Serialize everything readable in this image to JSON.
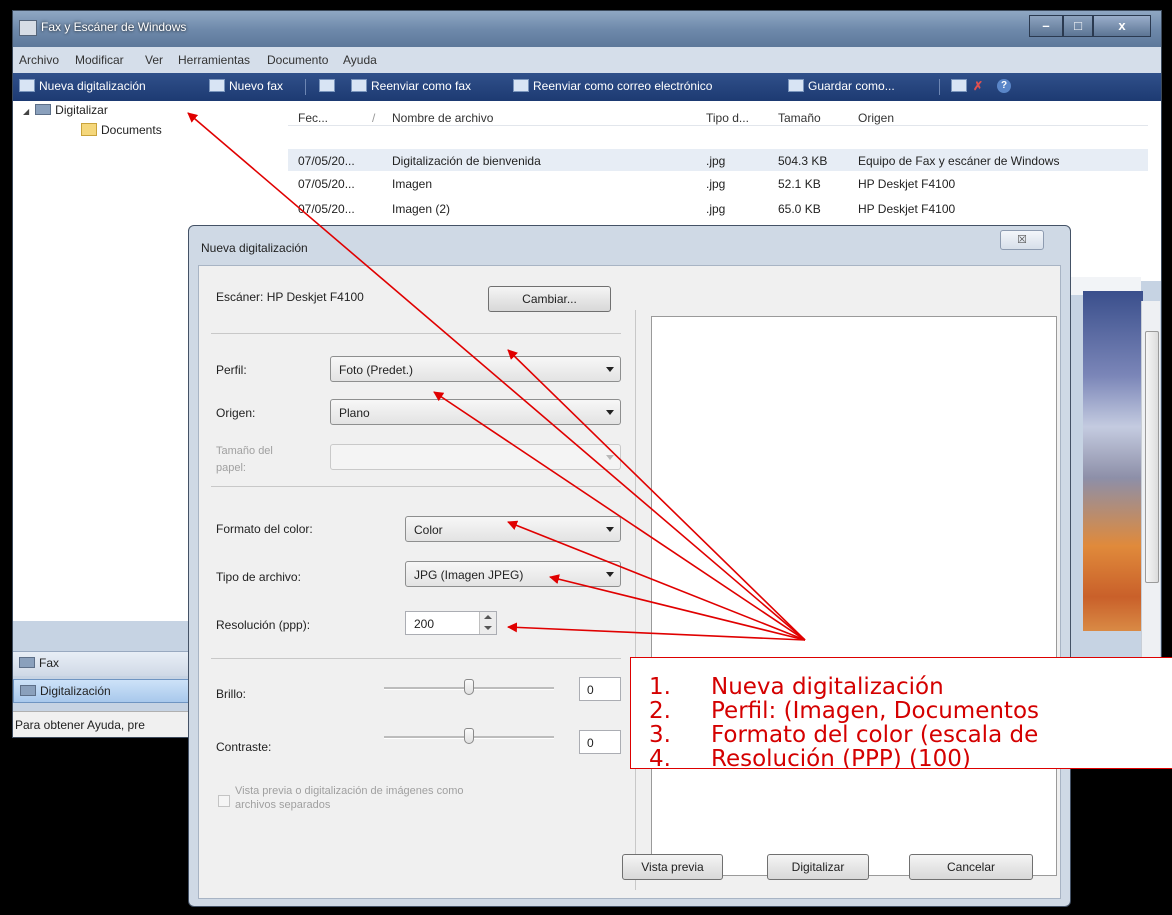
{
  "window": {
    "title": "Fax y Escáner de Windows",
    "min": "–",
    "max": "□",
    "close": "x"
  },
  "menu": [
    "Archivo",
    "Modificar",
    "Ver",
    "Herramientas",
    "Documento",
    "Ayuda"
  ],
  "toolbar": {
    "new_scan": "Nueva digitalización",
    "new_fax": "Nuevo fax",
    "forward_fax": "Reenviar como fax",
    "forward_email": "Reenviar como correo electrónico",
    "save_as": "Guardar como...",
    "help_glyph": "?",
    "delete_glyph": "✗"
  },
  "tree": {
    "root": "Digitalizar",
    "child": "Documents"
  },
  "nav": {
    "fax": "Fax",
    "scan": "Digitalización"
  },
  "status": "Para obtener Ayuda, pre",
  "filelist": {
    "columns": [
      "Fec...",
      "/",
      "Nombre de archivo",
      "Tipo d...",
      "Tamaño",
      "Origen"
    ],
    "rows": [
      {
        "date": "07/05/20...",
        "name": "Digitalización de bienvenida",
        "type": ".jpg",
        "size": "504.3 KB",
        "origin": "Equipo de Fax y escáner de Windows"
      },
      {
        "date": "07/05/20...",
        "name": "Imagen",
        "type": ".jpg",
        "size": "52.1 KB",
        "origin": "HP Deskjet F4100"
      },
      {
        "date": "07/05/20...",
        "name": "Imagen (2)",
        "type": ".jpg",
        "size": "65.0 KB",
        "origin": "HP Deskjet F4100"
      }
    ]
  },
  "dialog": {
    "title": "Nueva digitalización",
    "close": "☒",
    "scanner_label": "Escáner: HP Deskjet F4100",
    "change_button": "Cambiar...",
    "profile_label": "Perfil:",
    "profile_value": "Foto (Predet.)",
    "source_label": "Origen:",
    "source_value": "Plano",
    "paper_label_1": "Tamaño del",
    "paper_label_2": "papel:",
    "paper_value": "",
    "color_label": "Formato del color:",
    "color_value": "Color",
    "filetype_label": "Tipo de archivo:",
    "filetype_value": "JPG (Imagen JPEG)",
    "resolution_label": "Resolución (ppp):",
    "resolution_value": "200",
    "brightness_label": "Brillo:",
    "brightness_value": "0",
    "brightness_level": 0.5,
    "contrast_label": "Contraste:",
    "contrast_value": "0",
    "contrast_level": 0.5,
    "separate_files_1": "Vista previa o digitalización de imágenes como",
    "separate_files_2": "archivos separados",
    "preview_button": "Vista previa",
    "scan_button": "Digitalizar",
    "cancel_button": "Cancelar"
  },
  "annotation": {
    "color": "#d40000",
    "items": [
      {
        "num": "1.",
        "text": "Nueva digitalización"
      },
      {
        "num": "2.",
        "text": "Perfil: (Imagen, Documentos"
      },
      {
        "num": "3.",
        "text": "Formato del color (escala de"
      },
      {
        "num": "4.",
        "text": "Resolución (PPP) (100)"
      }
    ]
  }
}
